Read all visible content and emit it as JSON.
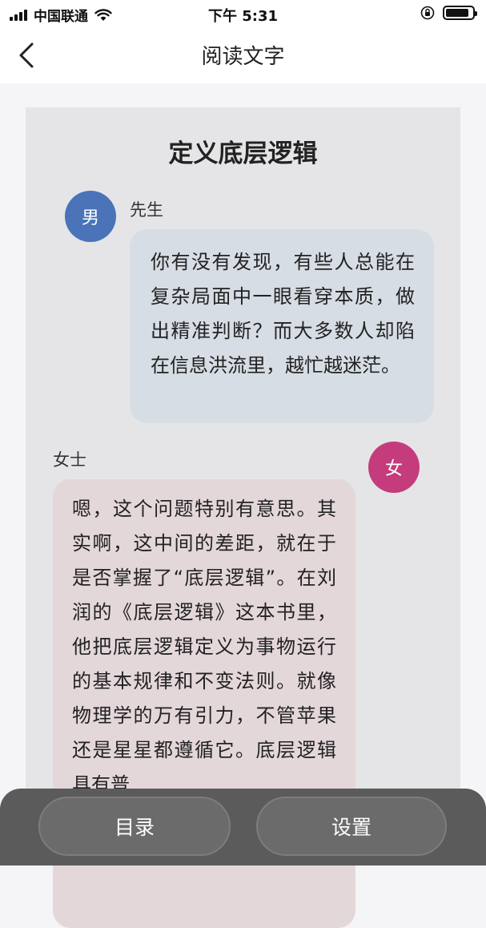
{
  "status_bar": {
    "carrier": "中国联通",
    "time": "下午 5:31",
    "icons": [
      "signal-icon",
      "wifi-icon",
      "orientation-lock-icon",
      "battery-icon"
    ]
  },
  "nav": {
    "title": "阅读文字",
    "back_icon": "chevron-left-icon"
  },
  "article": {
    "title": "定义底层逻辑",
    "messages": [
      {
        "avatar": "男",
        "speaker": "先生",
        "text": "你有没有发现，有些人总能在复杂局面中一眼看穿本质，做出精准判断？而大多数人却陷在信息洪流里，越忙越迷茫。"
      },
      {
        "avatar": "女",
        "speaker": "女士",
        "text": "嗯，这个问题特别有意思。其实啊，这中间的差距，就在于是否掌握了“底层逻辑”。在刘润的《底层逻辑》这本书里，他把底层逻辑定义为事物运行的基本规律和不变法则。就像物理学的万有引力，不管苹果还是星星都遵循它。底层逻辑具有普"
      }
    ]
  },
  "bottom_bar": {
    "toc_label": "目录",
    "settings_label": "设置"
  },
  "colors": {
    "male_avatar": "#4a73b8",
    "female_avatar": "#c43c7c",
    "male_bubble": "#d7dde4",
    "female_bubble": "#e4d7da"
  }
}
